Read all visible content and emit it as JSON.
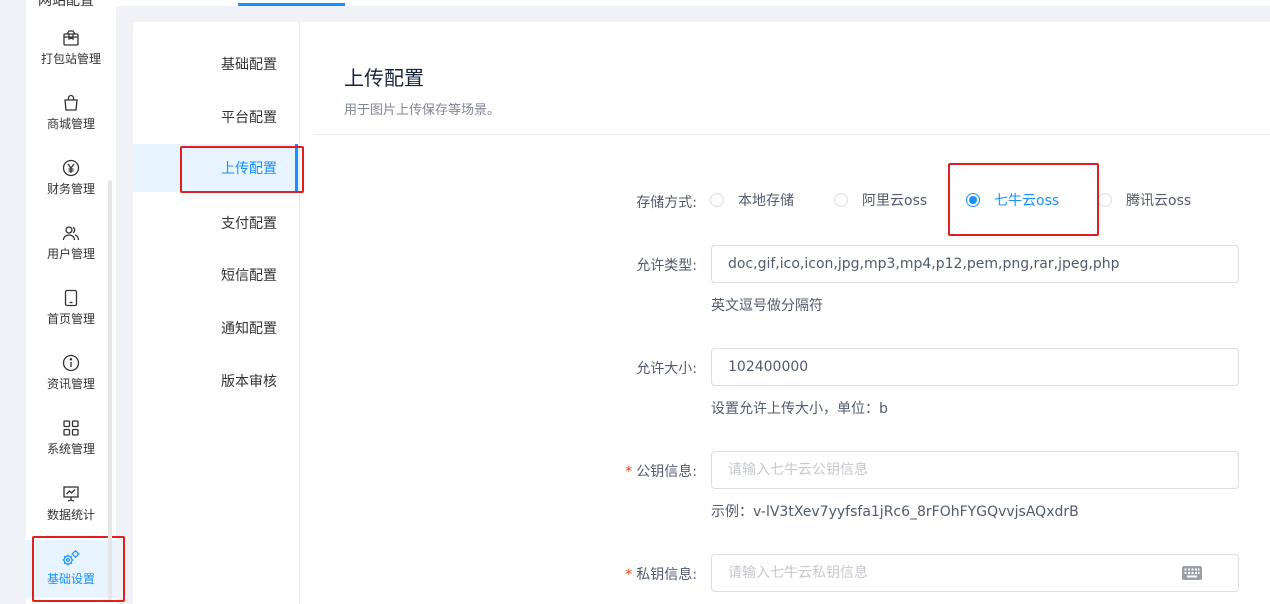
{
  "sidebar": {
    "top_partial_label": "网站配置",
    "items": [
      {
        "label": "打包站管理",
        "icon": "package-icon"
      },
      {
        "label": "商城管理",
        "icon": "shopping-bag-icon"
      },
      {
        "label": "财务管理",
        "icon": "yen-circle-icon"
      },
      {
        "label": "用户管理",
        "icon": "users-icon"
      },
      {
        "label": "首页管理",
        "icon": "tablet-icon"
      },
      {
        "label": "资讯管理",
        "icon": "info-circle-icon"
      },
      {
        "label": "系统管理",
        "icon": "grid-icon"
      },
      {
        "label": "数据统计",
        "icon": "chart-board-icon"
      },
      {
        "label": "基础设置",
        "icon": "gears-icon"
      }
    ],
    "active_index": 8
  },
  "config_nav": {
    "items": [
      "基础配置",
      "平台配置",
      "上传配置",
      "支付配置",
      "短信配置",
      "通知配置",
      "版本审核"
    ],
    "active_index": 2
  },
  "header": {
    "title": "上传配置",
    "description": "用于图片上传保存等场景。"
  },
  "form": {
    "storage": {
      "label": "存储方式:",
      "options": [
        "本地存储",
        "阿里云oss",
        "七牛云oss",
        "腾讯云oss"
      ],
      "selected_index": 2
    },
    "allowed_types": {
      "label": "允许类型:",
      "value": "doc,gif,ico,icon,jpg,mp3,mp4,p12,pem,png,rar,jpeg,php",
      "help": "英文逗号做分隔符"
    },
    "allowed_size": {
      "label": "允许大小:",
      "value": "102400000",
      "help": "设置允许上传大小，单位：b"
    },
    "public_key": {
      "required_mark": "*",
      "label": "公钥信息:",
      "placeholder": "请输入七牛云公钥信息",
      "help": "示例：v-lV3tXev7yyfsfa1jRc6_8rFOhFYGQvvjsAQxdrB"
    },
    "private_key": {
      "required_mark": "*",
      "label": "私钥信息:",
      "placeholder": "请输入七牛云私钥信息",
      "icon": "keyboard-icon"
    }
  },
  "colors": {
    "accent": "#1890ff",
    "highlight": "#e02020",
    "required": "#ed4014"
  }
}
